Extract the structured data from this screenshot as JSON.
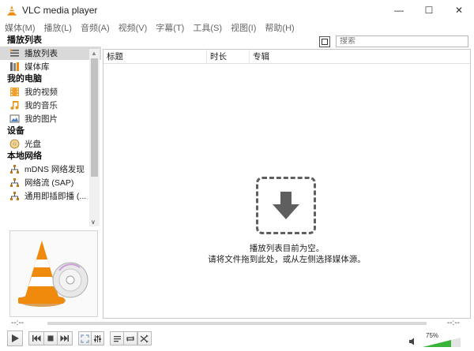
{
  "window": {
    "title": "VLC media player",
    "minimize_glyph": "—",
    "maximize_glyph": "☐",
    "close_glyph": "✕"
  },
  "menu": [
    {
      "label": "媒体(M)"
    },
    {
      "label": "播放(L)"
    },
    {
      "label": "音频(A)"
    },
    {
      "label": "视频(V)"
    },
    {
      "label": "字幕(T)"
    },
    {
      "label": "工具(S)"
    },
    {
      "label": "视图(I)"
    },
    {
      "label": "帮助(H)"
    }
  ],
  "sidebar": {
    "playlist_header": "播放列表",
    "playlist_items": [
      {
        "label": "播放列表",
        "icon": "playlist-icon",
        "selected": true
      },
      {
        "label": "媒体库",
        "icon": "library-icon",
        "selected": false
      }
    ],
    "computer_header": "我的电脑",
    "computer_items": [
      {
        "label": "我的视频",
        "icon": "video-icon"
      },
      {
        "label": "我的音乐",
        "icon": "music-icon"
      },
      {
        "label": "我的图片",
        "icon": "picture-icon"
      }
    ],
    "devices_header": "设备",
    "devices_items": [
      {
        "label": "光盘",
        "icon": "disc-icon"
      }
    ],
    "network_header": "本地网络",
    "network_items": [
      {
        "label": "mDNS 网络发现",
        "icon": "network-icon"
      },
      {
        "label": "网络流 (SAP)",
        "icon": "network-icon"
      },
      {
        "label": "通用即插即播 (...",
        "icon": "network-icon"
      }
    ],
    "expand_glyph": "∨"
  },
  "search": {
    "placeholder": "搜索"
  },
  "playlist": {
    "columns": [
      {
        "label": "标题"
      },
      {
        "label": "时长"
      },
      {
        "label": "专辑"
      }
    ],
    "empty_line1": "播放列表目前为空。",
    "empty_line2": "请将文件拖到此处，或从左侧选择媒体源。"
  },
  "seek": {
    "elapsed": "--:--",
    "total": "--:--",
    "position": 0
  },
  "volume": {
    "percent_label": "75%",
    "level": 0.75
  },
  "colors": {
    "vlc_orange": "#f08a0c",
    "volume_green": "#3ab53a",
    "dashed_box": "#5f5f5f"
  }
}
